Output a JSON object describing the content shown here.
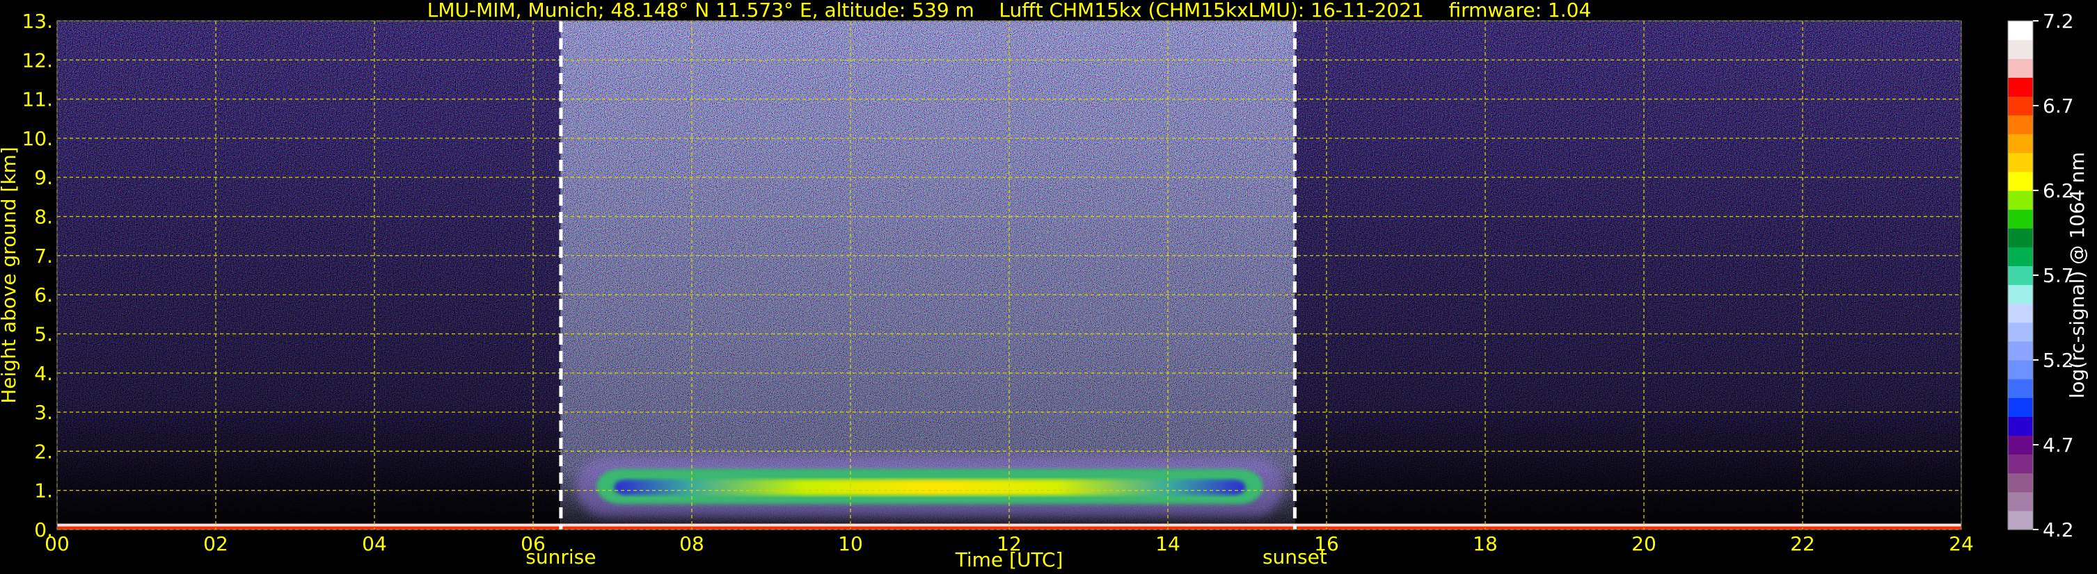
{
  "chart_data": {
    "type": "heatmap",
    "title": "LMU-MIM, Munich; 48.148° N 11.573° E, altitude: 539 m    Lufft CHM15kx (CHM15kxLMU): 16-11-2021    firmware: 1.04",
    "xlabel": "Time [UTC]",
    "ylabel": "Height above ground [km]",
    "xlim": [
      0,
      24
    ],
    "ylim": [
      0,
      13
    ],
    "x_ticks": [
      "00",
      "02",
      "04",
      "06",
      "08",
      "10",
      "12",
      "14",
      "16",
      "18",
      "20",
      "22",
      "24"
    ],
    "y_ticks": [
      "0.",
      "1.",
      "2.",
      "3.",
      "4.",
      "5.",
      "6.",
      "7.",
      "8.",
      "9.",
      "10.",
      "11.",
      "12.",
      "13."
    ],
    "grid": true,
    "markers": [
      {
        "label": "sunrise",
        "x": 6.35
      },
      {
        "label": "sunset",
        "x": 15.6
      }
    ],
    "colorbar": {
      "label": "log(rc-signal) @ 1064 nm",
      "range": [
        4.2,
        7.2
      ],
      "ticks": [
        "4.2",
        "4.7",
        "5.2",
        "5.7",
        "6.2",
        "6.7",
        "7.2"
      ],
      "colors": [
        "#b9a7c4",
        "#a67fa6",
        "#935a8e",
        "#7e2c86",
        "#6b0a88",
        "#2600d2",
        "#0b3bff",
        "#3d6eff",
        "#6d91ff",
        "#8aa4ff",
        "#a8bdff",
        "#c6d6ff",
        "#9ff0ea",
        "#3fd6a8",
        "#00b050",
        "#008a30",
        "#1fd000",
        "#8af000",
        "#ffff00",
        "#ffd200",
        "#ffaa00",
        "#ff7a00",
        "#ff3a00",
        "#ff0000",
        "#f7c0c0",
        "#efe6e6",
        "#ffffff"
      ]
    },
    "features": {
      "boundary_layer_band": {
        "x_start": 6.8,
        "x_end": 15.2,
        "height_bottom": 0.65,
        "height_top": 1.55,
        "core_value_range": [
          5.5,
          5.9
        ]
      },
      "surface_layer_height": 0.15,
      "daytime_noise_window": [
        6.35,
        15.6
      ]
    }
  }
}
